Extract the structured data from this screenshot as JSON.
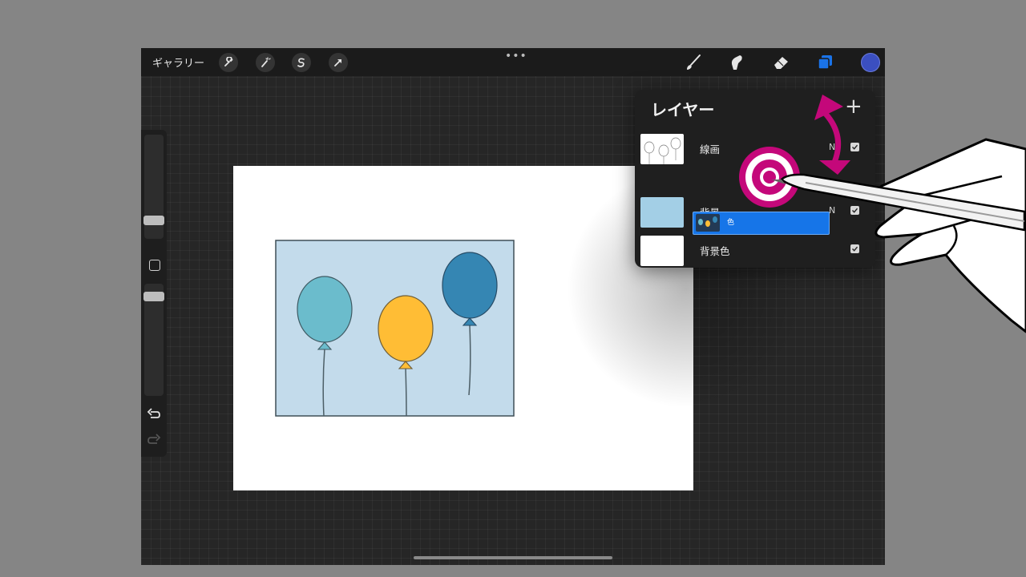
{
  "topbar": {
    "gallery_label": "ギャラリー",
    "more_dots": "•••",
    "tools_left": [
      "wrench-icon",
      "magic-wand-icon",
      "selection-s-icon",
      "transform-arrow-icon"
    ],
    "tools_right": [
      "brush-icon",
      "smudge-icon",
      "eraser-icon",
      "layers-icon"
    ],
    "current_color": "#3b4fc0"
  },
  "layers_panel": {
    "title": "レイヤー",
    "add_label": "+",
    "layers": [
      {
        "name": "線画",
        "blend": "N",
        "visible": true
      },
      {
        "name": "背景",
        "blend": "N",
        "visible": true
      },
      {
        "name": "背景色",
        "blend": "",
        "visible": true
      }
    ],
    "dragging_layer": {
      "label": "色"
    }
  },
  "colors": {
    "accent": "#1675e8",
    "annotation": "#c4087a",
    "balloon_teal": "#6bbccc",
    "balloon_yellow": "#ffbd35",
    "balloon_blue": "#3586b3",
    "background_layer": "#a3cfe6"
  }
}
